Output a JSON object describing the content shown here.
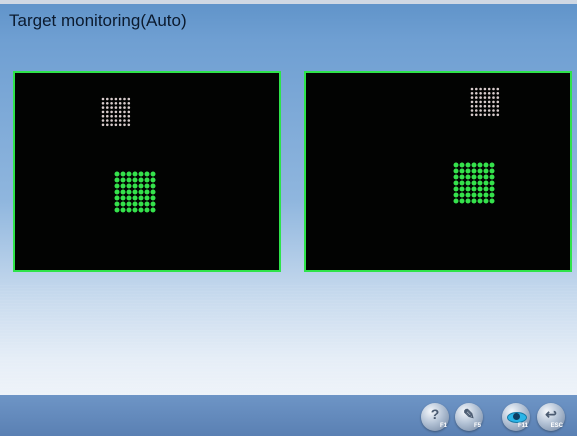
{
  "window": {
    "title": "Target monitoring(Auto)"
  },
  "colors": {
    "frame_border": "#2ee34a",
    "target_detected": "#35e24c",
    "target_reference": "#d8cccc",
    "panel_bg": "#020302"
  },
  "cameras": [
    {
      "name": "left"
    },
    {
      "name": "right"
    }
  ],
  "toolbar": {
    "buttons": [
      {
        "key": "F1",
        "icon": "help-icon"
      },
      {
        "key": "F5",
        "icon": "edit-icon"
      },
      {
        "key": "F11",
        "icon": "eye-icon"
      },
      {
        "key": "ESC",
        "icon": "return-icon"
      }
    ]
  }
}
